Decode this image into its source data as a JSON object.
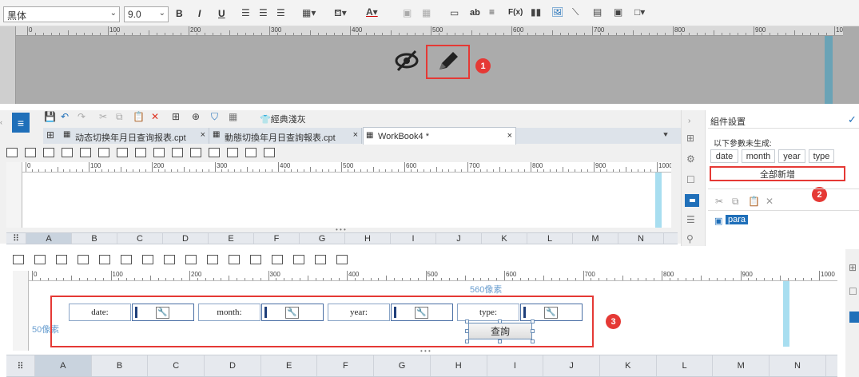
{
  "top_toolbar": {
    "font_family": "黑体",
    "font_size": "9.0",
    "bold": "B",
    "italic": "I",
    "underline": "U",
    "text_icon": "ab",
    "formula_icon": "F(x)"
  },
  "top_ruler": {
    "ticks": [
      "0",
      "100",
      "200",
      "300",
      "400",
      "500",
      "600",
      "700",
      "800",
      "900",
      "1000"
    ]
  },
  "badges": {
    "one": "1",
    "two": "2",
    "three": "3"
  },
  "designer": {
    "theme_label": "經典淺灰",
    "tabs": [
      {
        "label": "动态切换年月日查询报表.cpt",
        "close": "×"
      },
      {
        "label": "動態切換年月日查詢報表.cpt",
        "close": "×"
      },
      {
        "label": "WorkBook4 *",
        "close": "×"
      }
    ],
    "ruler_ticks": [
      "0",
      "100",
      "200",
      "300",
      "400",
      "500",
      "600",
      "700",
      "800",
      "900",
      "1000"
    ],
    "columns": [
      "A",
      "B",
      "C",
      "D",
      "E",
      "F",
      "G",
      "H",
      "I",
      "J",
      "K",
      "L",
      "M",
      "N"
    ]
  },
  "right_panel": {
    "title": "組件設置",
    "subtitle": "以下參數未生成:",
    "params": [
      "date",
      "month",
      "year",
      "type"
    ],
    "add_all": "全部新增",
    "para_label": "para"
  },
  "param_pane": {
    "ruler_ticks": [
      "0",
      "100",
      "200",
      "300",
      "400",
      "500",
      "600",
      "700",
      "800",
      "900",
      "1000"
    ],
    "width_label": "560像素",
    "height_label": "50像素",
    "fields": [
      {
        "label": "date:"
      },
      {
        "label": "month:"
      },
      {
        "label": "year:"
      },
      {
        "label": "type:"
      }
    ],
    "query_button": "查詢"
  },
  "bottom_grid": {
    "columns": [
      "A",
      "B",
      "C",
      "D",
      "E",
      "F",
      "G",
      "H",
      "I",
      "J",
      "K",
      "L",
      "M",
      "N"
    ]
  }
}
